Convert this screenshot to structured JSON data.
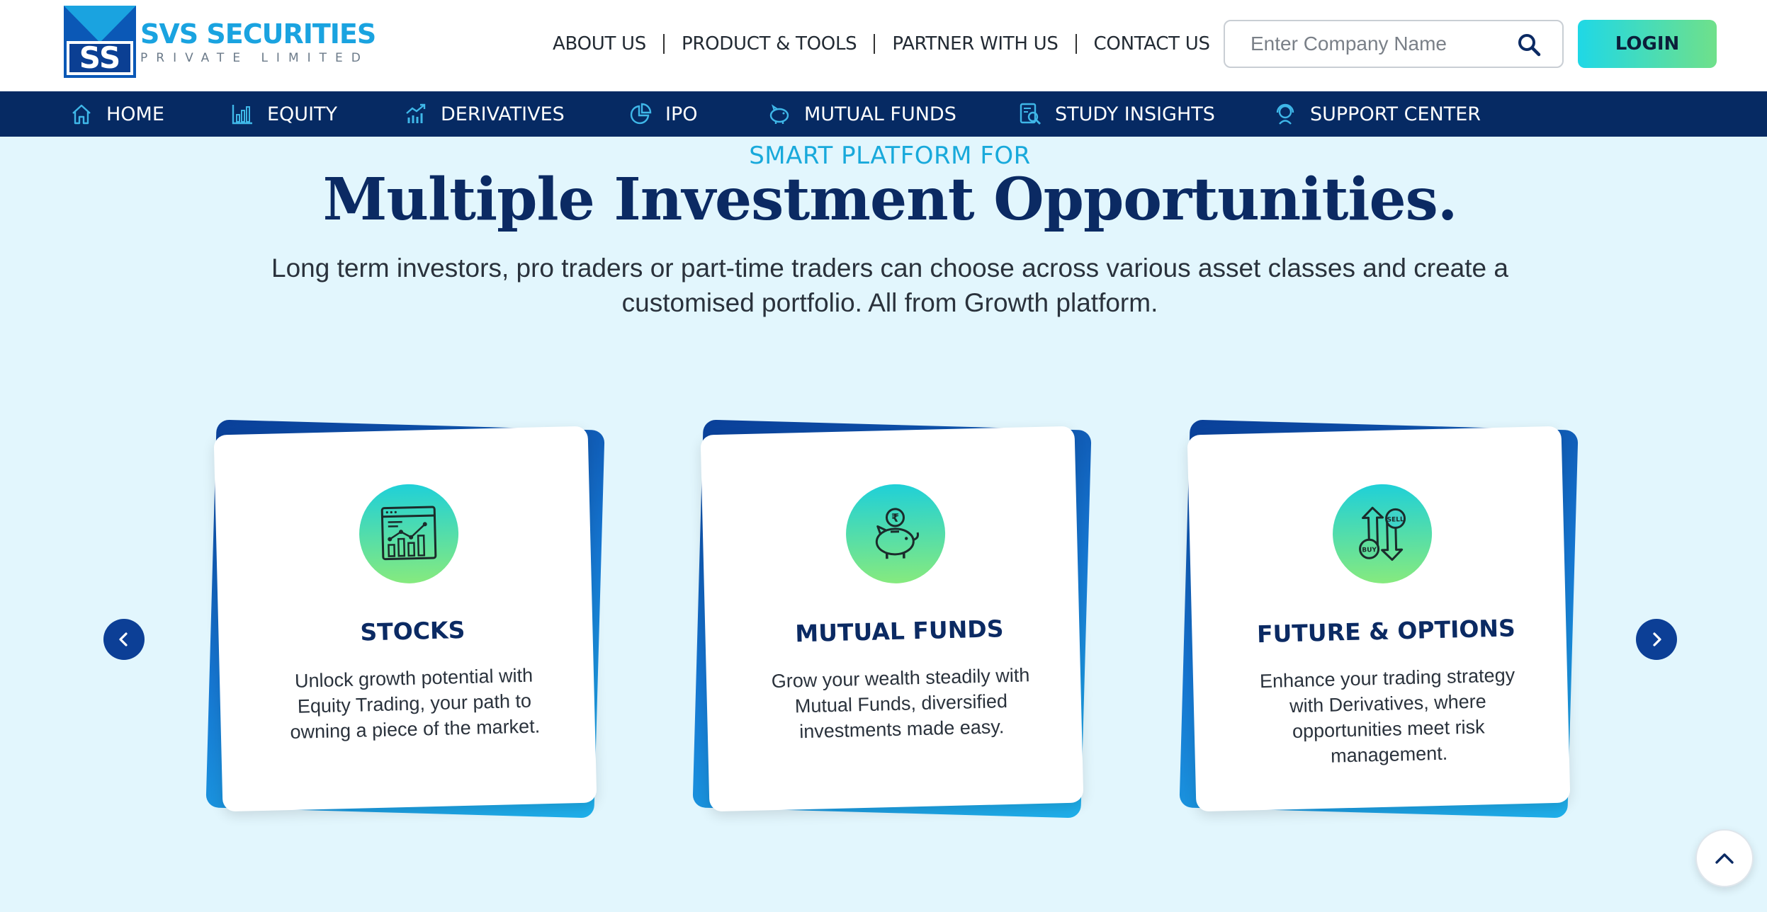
{
  "brand": {
    "name": "SVS SECURITIES",
    "subtitle": "PRIVATE LIMITED",
    "mark": "SS",
    "colors": {
      "primary": "#0b58b6",
      "accent": "#1aa3e0",
      "navy": "#062a63"
    }
  },
  "top_nav": {
    "items": [
      {
        "label": "ABOUT US"
      },
      {
        "label": "PRODUCT & TOOLS"
      },
      {
        "label": "PARTNER WITH US"
      },
      {
        "label": "CONTACT US"
      }
    ]
  },
  "search": {
    "placeholder": "Enter Company Name",
    "icon": "search-icon"
  },
  "login": {
    "label": "LOGIN"
  },
  "main_nav": {
    "items": [
      {
        "label": "HOME",
        "icon": "home-icon"
      },
      {
        "label": "EQUITY",
        "icon": "bar-chart-icon"
      },
      {
        "label": "DERIVATIVES",
        "icon": "trend-chart-icon"
      },
      {
        "label": "IPO",
        "icon": "pie-chart-icon"
      },
      {
        "label": "MUTUAL FUNDS",
        "icon": "piggy-bank-icon"
      },
      {
        "label": "STUDY INSIGHTS",
        "icon": "report-search-icon"
      },
      {
        "label": "SUPPORT CENTER",
        "icon": "headset-icon"
      }
    ]
  },
  "hero": {
    "eyebrow": "SMART PLATFORM FOR",
    "headline": "Multiple Investment Opportunities.",
    "lead": "Long term investors, pro traders or part-time traders can choose across various asset classes and create a customised portfolio. All from Growth platform."
  },
  "cards": [
    {
      "title": "STOCKS",
      "description": "Unlock growth potential with Equity Trading, your path to owning a piece of the market.",
      "icon": "stock-chart-icon"
    },
    {
      "title": "MUTUAL FUNDS",
      "description": "Grow your wealth steadily with Mutual Funds, diversified investments made easy.",
      "icon": "piggy-bank-rupee-icon"
    },
    {
      "title": "FUTURE & OPTIONS",
      "description": "Enhance your trading strategy with Derivatives, where opportunities meet risk management.",
      "icon": "buy-sell-icon"
    }
  ],
  "carousel": {
    "prev_icon": "chevron-left-icon",
    "next_icon": "chevron-right-icon"
  },
  "scroll_top": {
    "icon": "chevron-up-icon"
  },
  "badges": {
    "buy": "BUY",
    "sell": "SELL",
    "rupee": "₹"
  }
}
